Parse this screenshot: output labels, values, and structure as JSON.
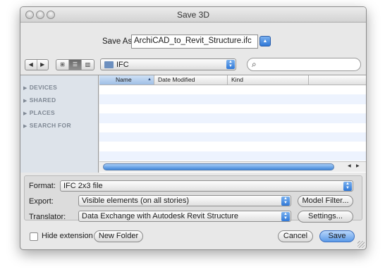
{
  "window": {
    "title": "Save 3D"
  },
  "save_as": {
    "label": "Save As:",
    "value": "ArchiCAD_to_Revit_Structure.ifc"
  },
  "toolbar": {
    "back_glyph": "◀",
    "forward_glyph": "▶",
    "view_icon_glyph": "⊞",
    "view_list_glyph": "☰",
    "view_column_glyph": "▥",
    "folder_name": "IFC",
    "search_value": ""
  },
  "sidebar": {
    "sections": [
      {
        "label": "DEVICES"
      },
      {
        "label": "SHARED"
      },
      {
        "label": "PLACES"
      },
      {
        "label": "SEARCH FOR"
      }
    ]
  },
  "columns": {
    "name": "Name",
    "date_modified": "Date Modified",
    "kind": "Kind"
  },
  "options": {
    "format": {
      "label": "Format:",
      "value": "IFC 2x3 file"
    },
    "export": {
      "label": "Export:",
      "value": "Visible elements (on all stories)",
      "button": "Model Filter..."
    },
    "translator": {
      "label": "Translator:",
      "value": "Data Exchange with Autodesk Revit Structure",
      "button": "Settings..."
    }
  },
  "footer": {
    "hide_extension_label": "Hide extension",
    "hide_extension_checked": false,
    "new_folder_label": "New Folder",
    "cancel_label": "Cancel",
    "save_label": "Save"
  },
  "colors": {
    "accent": "#3b82d8",
    "sidebar_bg": "#dde3ea",
    "alt_row": "#edf3fe"
  }
}
